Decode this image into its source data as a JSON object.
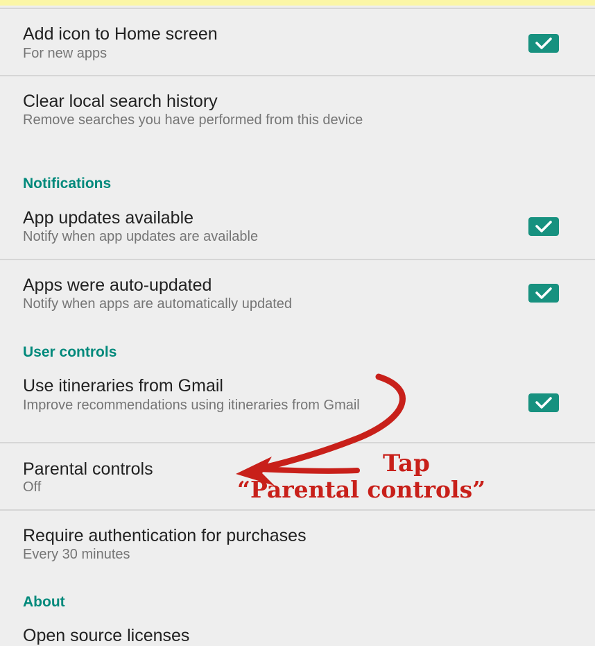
{
  "settings": {
    "add_icon": {
      "title": "Add icon to Home screen",
      "subtitle": "For new apps",
      "checked": true
    },
    "clear_history": {
      "title": "Clear local search history",
      "subtitle": "Remove searches you have performed from this device"
    },
    "notifications_header": "Notifications",
    "app_updates": {
      "title": "App updates available",
      "subtitle": "Notify when app updates are available",
      "checked": true
    },
    "auto_updated": {
      "title": "Apps were auto-updated",
      "subtitle": "Notify when apps are automatically updated",
      "checked": true
    },
    "user_controls_header": "User controls",
    "itineraries": {
      "title": "Use itineraries from Gmail",
      "subtitle": "Improve recommendations using itineraries from Gmail",
      "checked": true
    },
    "parental": {
      "title": "Parental controls",
      "subtitle": "Off"
    },
    "auth": {
      "title": "Require authentication for purchases",
      "subtitle": "Every 30 minutes"
    },
    "about_header": "About",
    "licenses": {
      "title": "Open source licenses"
    }
  },
  "annotation": {
    "line1": "Tap",
    "line2": "“Parental controls”"
  },
  "colors": {
    "accent": "#00897b",
    "checkbox": "#17917f",
    "annotation": "#c8201a",
    "highlight_strip": "#fbf6a6"
  },
  "icons": {
    "checkbox": "checkmark",
    "annotation_arrow": "curved-arrow"
  }
}
